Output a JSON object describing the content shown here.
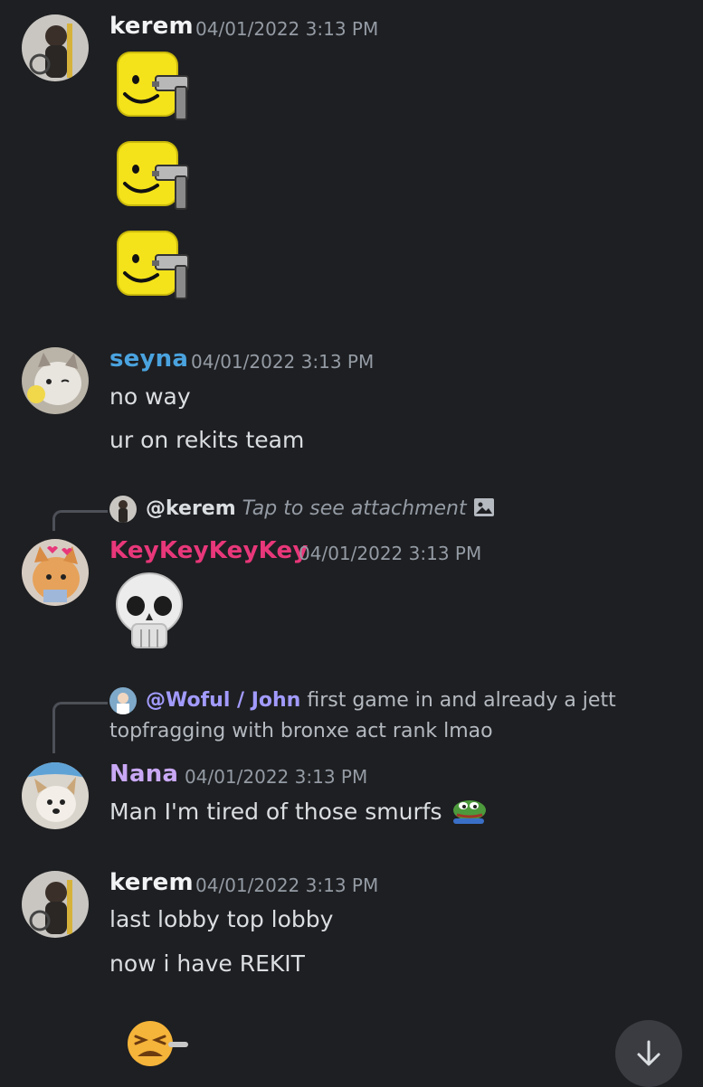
{
  "messages": [
    {
      "author": "kerem",
      "author_color": "#f2f3f5",
      "timestamp": "04/01/2022 3:13 PM",
      "stickers": [
        "gun-noob-emoji",
        "gun-noob-emoji",
        "gun-noob-emoji"
      ]
    },
    {
      "author": "seyna",
      "author_color": "#4aa3df",
      "timestamp": "04/01/2022 3:13 PM",
      "lines": [
        "no way",
        "ur on rekits team"
      ]
    },
    {
      "reply": {
        "mention": "@kerem",
        "text": "Tap to see attachment"
      },
      "author": "KeyKeyKeyKey",
      "author_color": "#e8377a",
      "timestamp": "04/01/2022 3:13 PM",
      "emoji": "skull-emoji"
    },
    {
      "reply": {
        "mention": "@Woful / John",
        "text_line1": "first game in and already a jett",
        "text_line2": "topfragging with bronxe act rank lmao"
      },
      "author": "Nana",
      "author_color": "#c9a8f5",
      "timestamp": "04/01/2022 3:13 PM",
      "lines": [
        "Man I'm tired of those smurfs"
      ],
      "inline_emoji": "pepe-emoji"
    },
    {
      "author": "kerem",
      "author_color": "#f2f3f5",
      "timestamp": "04/01/2022 3:13 PM",
      "lines": [
        "last lobby top lobby",
        "now i have REKIT"
      ],
      "emoji": "tired-face-smoking-emoji"
    }
  ],
  "mention_color": "#a29bfe",
  "scroll_button_icon": "arrow-down-icon"
}
